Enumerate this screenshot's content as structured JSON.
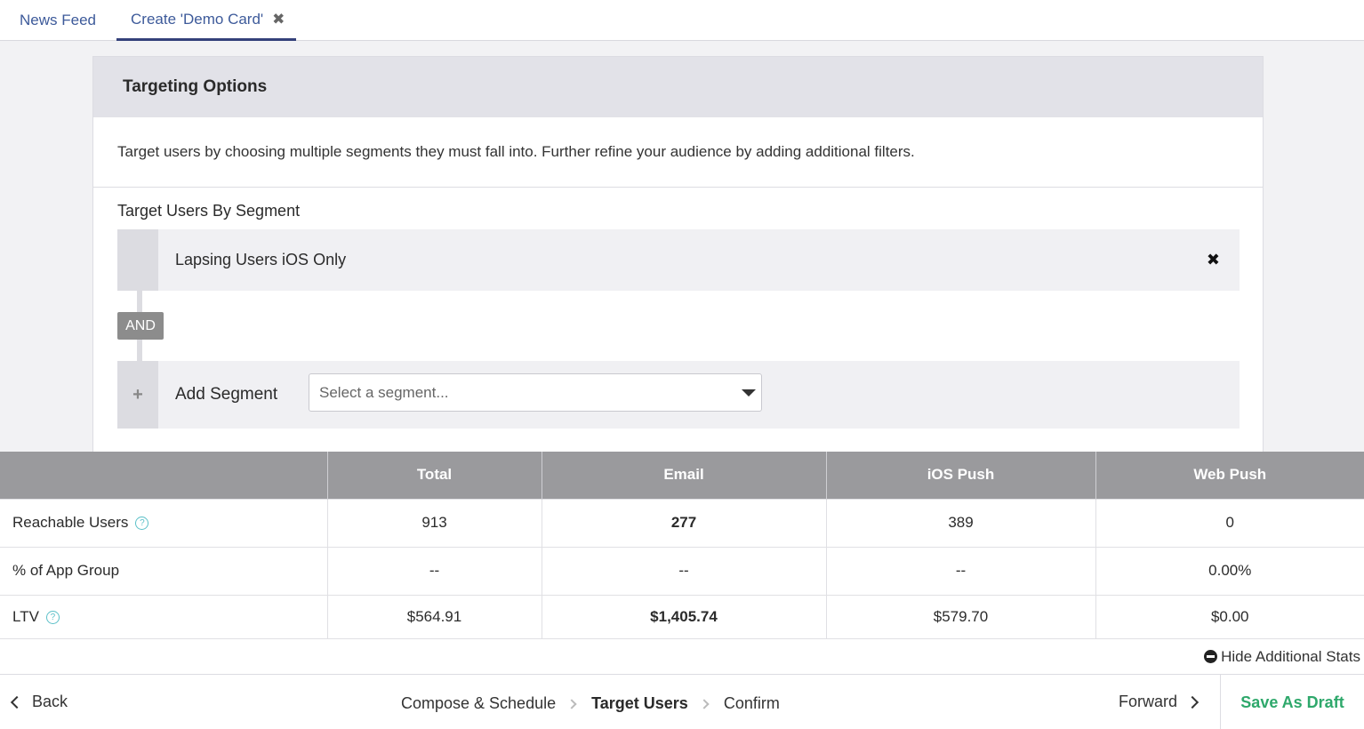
{
  "tabs": {
    "news_feed": "News Feed",
    "create": "Create 'Demo Card'",
    "close_icon": "✖"
  },
  "panel": {
    "title": "Targeting Options",
    "description": "Target users by choosing multiple segments they must fall into. Further refine your audience by adding additional filters.",
    "segment_title": "Target Users By Segment",
    "selected_segment": "Lapsing Users iOS Only",
    "remove_icon": "✖",
    "and_label": "AND",
    "add_icon": "+",
    "add_label": "Add Segment",
    "select_placeholder": "Select a segment..."
  },
  "stats": {
    "columns": [
      "",
      "Total",
      "Email",
      "iOS Push",
      "Web Push"
    ],
    "rows": [
      {
        "label": "Reachable Users",
        "help": "?",
        "values": [
          "913",
          "277",
          "389",
          "0"
        ]
      },
      {
        "label": "% of App Group",
        "help": "",
        "values": [
          "--",
          "--",
          "--",
          "0.00%"
        ]
      },
      {
        "label": "LTV",
        "help": "?",
        "values": [
          "$564.91",
          "$1,405.74",
          "$579.70",
          "$0.00"
        ]
      }
    ],
    "hide_label": "Hide Additional Stats"
  },
  "footer": {
    "back": "Back",
    "steps": [
      "Compose & Schedule",
      "Target Users",
      "Confirm"
    ],
    "forward": "Forward",
    "save_draft": "Save As Draft"
  },
  "colors": {
    "accent_green": "#2ea86b",
    "tab_active": "#34417a",
    "help_icon": "#5bc0c8"
  }
}
